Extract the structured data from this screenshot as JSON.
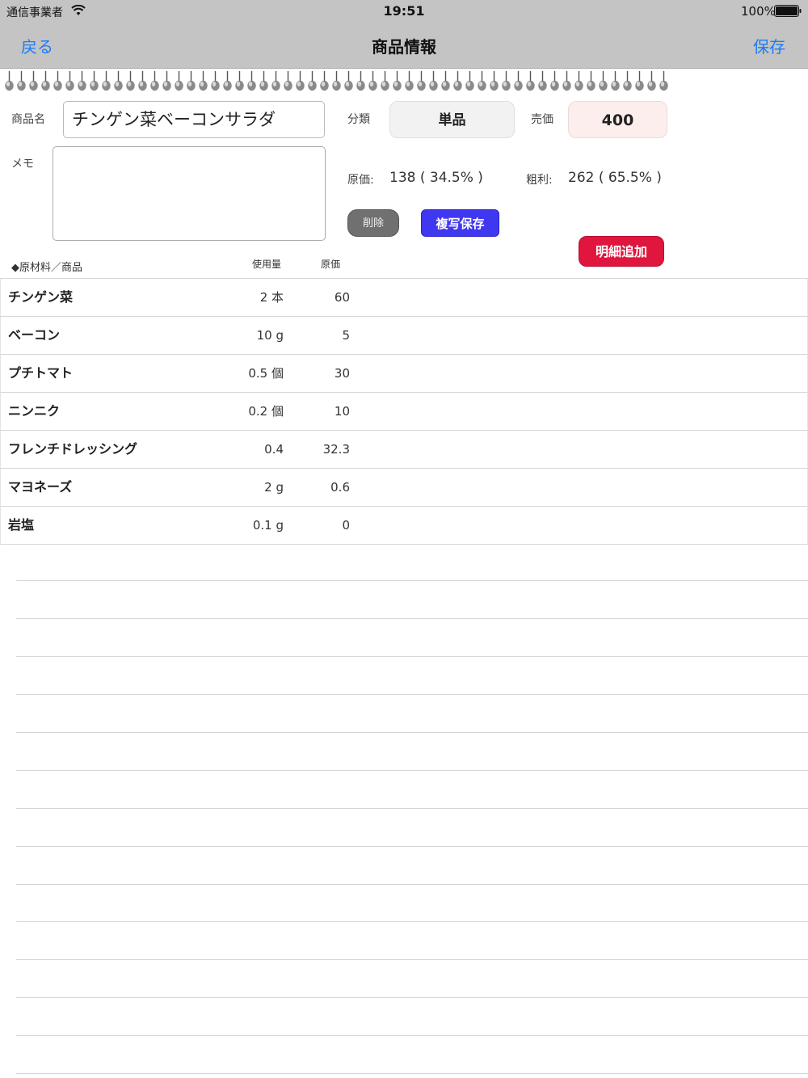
{
  "status_bar": {
    "carrier": "通信事業者",
    "time": "19:51",
    "battery": "100%"
  },
  "nav": {
    "back_label": "戻る",
    "title": "商品情報",
    "save_label": "保存"
  },
  "form": {
    "name_label": "商品名",
    "name_value": "チンゲン菜ベーコンサラダ",
    "memo_label": "メモ",
    "memo_value": "",
    "category_label": "分類",
    "category_value": "単品",
    "price_label": "売価",
    "price_value": "400",
    "cost_label": "原価:",
    "cost_value": "138 ( 34.5% )",
    "profit_label": "粗利:",
    "profit_value": "262 ( 65.5% )"
  },
  "actions": {
    "delete_label": "削除",
    "copy_save_label": "複写保存",
    "add_detail_label": "明細追加"
  },
  "table": {
    "headers": {
      "material": "◆原材料／商品",
      "usage": "使用量",
      "cost": "原価"
    },
    "rows": [
      {
        "name": "チンゲン菜",
        "qty": "2 本",
        "cost": "60"
      },
      {
        "name": "ベーコン",
        "qty": "10 g",
        "cost": "5"
      },
      {
        "name": "プチトマト",
        "qty": "0.5 個",
        "cost": "30"
      },
      {
        "name": "ニンニク",
        "qty": "0.2 個",
        "cost": "10"
      },
      {
        "name": "フレンチドレッシング",
        "qty": "0.4",
        "cost": "32.3"
      },
      {
        "name": "マヨネーズ",
        "qty": "2 g",
        "cost": "0.6"
      },
      {
        "name": "岩塩",
        "qty": "0.1 g",
        "cost": "0"
      }
    ]
  },
  "colors": {
    "nav_bar": "#c4c4c4",
    "link_blue": "#1a7cf5",
    "copy_button": "#4038f0",
    "add_button": "#e0163f",
    "delete_button": "#707070",
    "price_box": "#fdeeee"
  }
}
